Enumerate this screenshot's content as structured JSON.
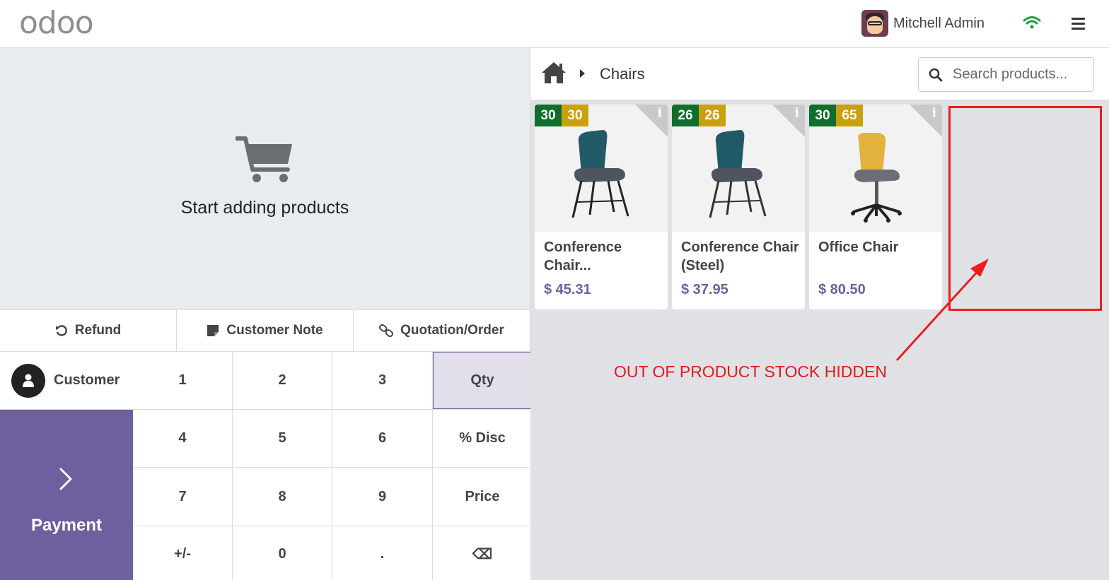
{
  "header": {
    "logo_text": "odoo",
    "user_name": "Mitchell Admin",
    "wifi_icon": "wifi-icon",
    "menu_icon": "hamburger-menu-icon"
  },
  "order": {
    "empty_message": "Start adding products",
    "controls": [
      {
        "label": "Refund",
        "icon": "undo-icon"
      },
      {
        "label": "Customer Note",
        "icon": "sticky-note-icon"
      },
      {
        "label": "Quotation/Order",
        "icon": "link-icon"
      }
    ],
    "customer_label": "Customer",
    "payment_label": "Payment"
  },
  "numpad": {
    "keys": [
      "1",
      "2",
      "3",
      "Qty",
      "4",
      "5",
      "6",
      "% Disc",
      "7",
      "8",
      "9",
      "Price",
      "+/-",
      "0",
      ".",
      "⌫"
    ],
    "active_mode": "Qty"
  },
  "catalog": {
    "breadcrumb": "Chairs",
    "search_placeholder": "Search products...",
    "products": [
      {
        "name": "Conference Chair...",
        "price": "$ 45.31",
        "stock_badge_green": "30",
        "stock_badge_yellow": "30",
        "image": "teal chair with black legs"
      },
      {
        "name": "Conference Chair (Steel)",
        "price": "$ 37.95",
        "stock_badge_green": "26",
        "stock_badge_yellow": "26",
        "image": "teal chair with steel legs"
      },
      {
        "name": "Office Chair",
        "price": "$ 80.50",
        "stock_badge_green": "30",
        "stock_badge_yellow": "65",
        "image": "yellow office swivel chair"
      }
    ]
  },
  "annotation": {
    "text": "OUT OF PRODUCT STOCK HIDDEN",
    "color": "#e01b1b"
  },
  "colors": {
    "brand": "#714b67",
    "accent": "#6f5f9f",
    "badge_green": "#0f6e2c",
    "badge_yellow": "#c9a10c"
  }
}
